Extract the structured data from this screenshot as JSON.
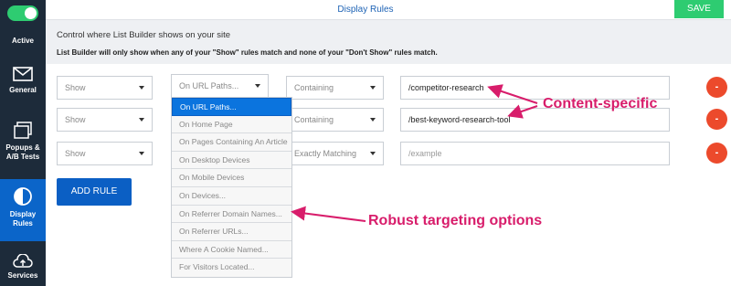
{
  "sidebar": {
    "toggle_on": true,
    "items": [
      {
        "label": "Active",
        "icon": "toggle-switch"
      },
      {
        "label": "General",
        "icon": "envelope-icon"
      },
      {
        "label": "Popups & A/B Tests",
        "icon": "stacked-pages-icon"
      },
      {
        "label": "Display Rules",
        "icon": "half-circle-icon",
        "active": true
      },
      {
        "label": "Services",
        "icon": "cloud-upload-icon"
      }
    ]
  },
  "header": {
    "title": "Display Rules",
    "save_label": "SAVE"
  },
  "heading": "Control where List Builder shows on your site",
  "subtext": "List Builder will only show when any of your \"Show\" rules match and none of your \"Don't Show\" rules match.",
  "rules": [
    {
      "show": "Show",
      "condition": "On URL Paths...",
      "matcher": "Containing",
      "value": "/competitor-research",
      "remove": "-"
    },
    {
      "show": "Show",
      "condition": "",
      "matcher": "Containing",
      "value": "/best-keyword-research-tool",
      "remove": "-"
    },
    {
      "show": "Show",
      "condition": "",
      "matcher": "Exactly Matching",
      "value": "",
      "placeholder": "/example",
      "remove": "-"
    }
  ],
  "add_rule_label": "ADD RULE",
  "dropdown_options": [
    "On URL Paths...",
    "On Home Page",
    "On Pages Containing An Article",
    "On Desktop Devices",
    "On Mobile Devices",
    "On Devices...",
    "On Referrer Domain Names...",
    "On Referrer URLs...",
    "Where A Cookie Named...",
    "For Visitors Located..."
  ],
  "dropdown_selected_index": 0,
  "annotations": {
    "content_specific": "Content-specific",
    "robust_targeting": "Robust targeting options"
  },
  "colors": {
    "sidebar": "#1d2b3a",
    "active_nav": "#0b65c9",
    "save": "#2ecc71",
    "remove": "#ec4a2c",
    "annotation": "#d81d6b"
  }
}
